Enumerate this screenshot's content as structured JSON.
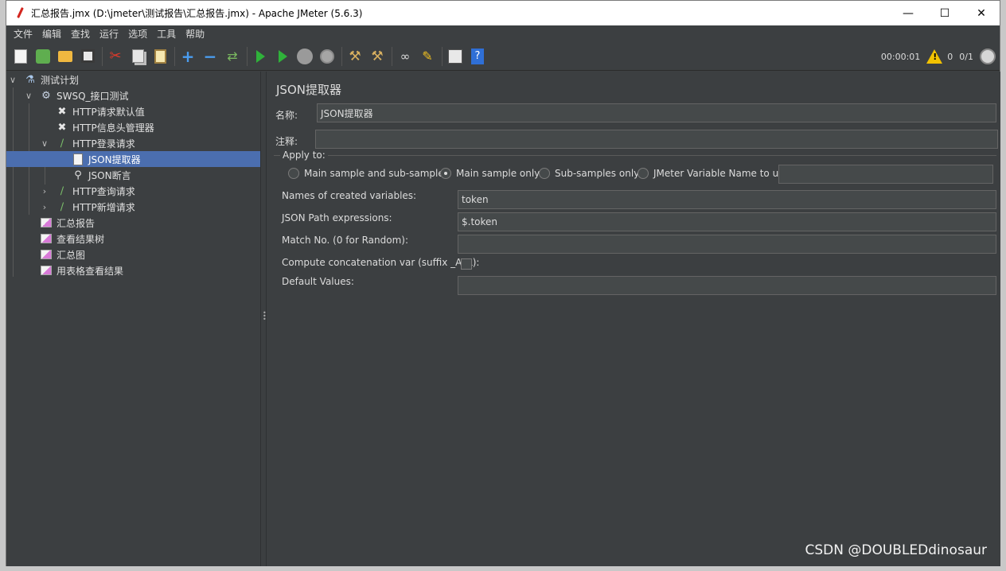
{
  "window": {
    "title": "汇总报告.jmx (D:\\jmeter\\测试报告\\汇总报告.jmx) - Apache JMeter (5.6.3)"
  },
  "menubar": {
    "items": [
      "文件",
      "编辑",
      "查找",
      "运行",
      "选项",
      "工具",
      "帮助"
    ]
  },
  "toolbar": {
    "icons": [
      "new-icon",
      "templates-icon",
      "open-icon",
      "save-icon",
      "cut-icon",
      "copy-icon",
      "paste-icon",
      "expand-icon",
      "collapse-icon",
      "toggle-icon",
      "start-icon",
      "start-no-pause-icon",
      "stop-icon",
      "shutdown-icon",
      "clear-icon",
      "clear-all-icon",
      "search-icon",
      "reset-search-icon",
      "function-helper-icon",
      "help-icon"
    ],
    "timer": "00:00:01",
    "warnings": "0",
    "threads": "0/1"
  },
  "tree": {
    "items": [
      {
        "label": "测试计划",
        "icon": "test-plan-icon"
      },
      {
        "label": "SWSQ_接口测试",
        "icon": "thread-group-gear-icon"
      },
      {
        "label": "HTTP请求默认值",
        "icon": "config-tools-icon"
      },
      {
        "label": "HTTP信息头管理器",
        "icon": "config-tools-icon"
      },
      {
        "label": "HTTP登录请求",
        "icon": "sampler-pipette-icon"
      },
      {
        "label": "JSON提取器",
        "icon": "extractor-doc-icon"
      },
      {
        "label": "JSON断言",
        "icon": "assertion-magnifier-icon"
      },
      {
        "label": "HTTP查询请求",
        "icon": "sampler-pipette-icon"
      },
      {
        "label": "HTTP新增请求",
        "icon": "sampler-pipette-icon"
      },
      {
        "label": "汇总报告",
        "icon": "listener-chart-icon"
      },
      {
        "label": "查看结果树",
        "icon": "listener-chart-icon"
      },
      {
        "label": "汇总图",
        "icon": "listener-chart-icon"
      },
      {
        "label": "用表格查看结果",
        "icon": "listener-chart-icon"
      }
    ],
    "selected": "JSON提取器"
  },
  "panel": {
    "title": "JSON提取器",
    "name_label": "名称:",
    "name_value": "JSON提取器",
    "comment_label": "注释:",
    "comment_value": "",
    "apply_to_legend": "Apply to:",
    "apply_options": [
      "Main sample and sub-samples",
      "Main sample only",
      "Sub-samples only",
      "JMeter Variable Name to use"
    ],
    "apply_selected": "Main sample only",
    "jmeter_var_value": "",
    "fields": [
      {
        "label": "Names of created variables:",
        "value": "token"
      },
      {
        "label": "JSON Path expressions:",
        "value": "$.token"
      },
      {
        "label": "Match No. (0 for Random):",
        "value": ""
      }
    ],
    "concat_label": "Compute concatenation var (suffix _ALL):",
    "concat_checked": false,
    "default_label": "Default Values:",
    "default_value": ""
  },
  "watermark": "CSDN @DOUBLEDdinosaur"
}
